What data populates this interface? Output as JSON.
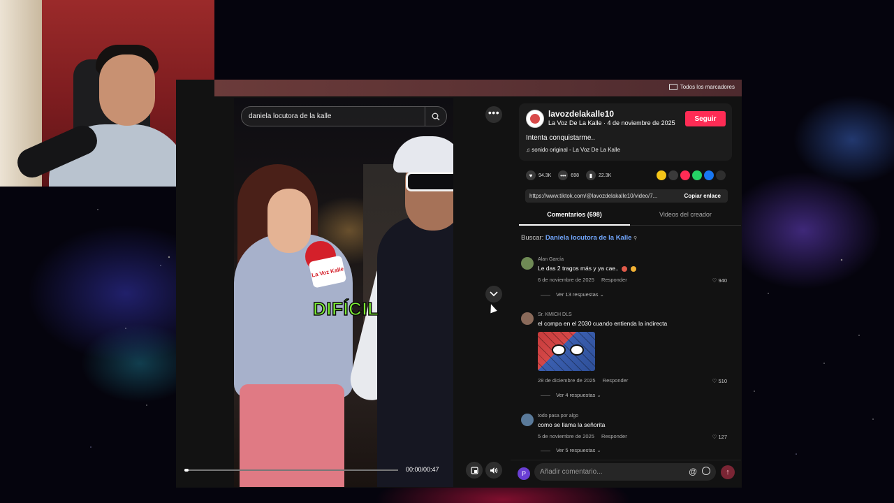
{
  "browser": {
    "bookmarks_label": "Todos los marcadores"
  },
  "video": {
    "search_query": "daniela locutora de la kalle",
    "caption": "DIFÍCIL",
    "mic_logo_text": "La Voz Kalle",
    "time": "00:00/00:47",
    "progress_fraction": 0.02
  },
  "post": {
    "username": "lavozdelakalle10",
    "subtitle": "La Voz De La Kalle · 4 de noviembre de 2025",
    "follow_label": "Seguir",
    "description": "Intenta conquistarme..",
    "sound": "sonido original - La Voz De La Kalle",
    "likes": "94.3K",
    "comments": "698",
    "saves": "22.3K",
    "link_url": "https://www.tiktok.com/@lavozdelakalle10/video/7...",
    "copy_link_label": "Copiar enlace",
    "share_colors": [
      "#f5c518",
      "#3a3a3a",
      "#fe2c55",
      "#25d366",
      "#1877f2",
      "#2e2e2e"
    ]
  },
  "tabs": [
    {
      "label": "Comentarios (698)",
      "active": true
    },
    {
      "label": "Videos del creador",
      "active": false
    }
  ],
  "search_line": {
    "prefix": "Buscar:",
    "term": "Daniela locutora de la Kalle"
  },
  "comments": [
    {
      "user": "Alan García",
      "text": "Le das 2 tragos más y ya cae..",
      "date": "6 de noviembre de 2025",
      "reply_label": "Responder",
      "likes": "940",
      "replies_label": "Ver 13 respuestas",
      "avatar_color": "#6f8a55"
    },
    {
      "user": "Sr. KMICH DLS",
      "text": "el compa en el 2030 cuando entienda la indirecta",
      "date": "28 de diciembre de 2025",
      "reply_label": "Responder",
      "likes": "510",
      "replies_label": "Ver 4 respuestas",
      "avatar_color": "#8a6a5a"
    },
    {
      "user": "todo pasa por algo",
      "text": "como se llama la señorita",
      "date": "5 de noviembre de 2025",
      "reply_label": "Responder",
      "likes": "127",
      "replies_label": "Ver 5 respuestas",
      "avatar_color": "#5a7a9a"
    }
  ],
  "composer": {
    "avatar_letter": "P",
    "placeholder": "Añadir comentario..."
  }
}
